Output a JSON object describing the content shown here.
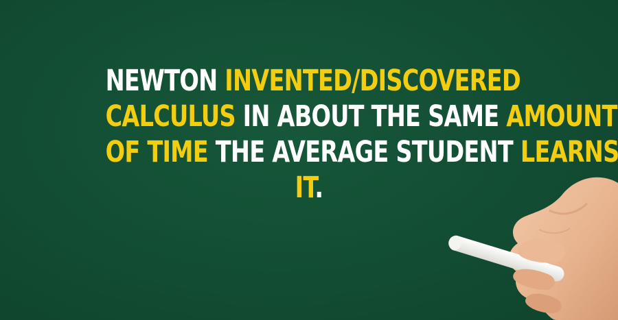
{
  "quote": {
    "line1": {
      "part1": "NEWTON",
      "part2": "INVENTED/DISCOVERED"
    },
    "line2": {
      "part1": "CALCULUS",
      "part2": "IN ABOUT THE SAME",
      "part3": "AMOUNT"
    },
    "line3": {
      "part1": "OF TIME",
      "part2": "THE AVERAGE STUDENT",
      "part3": "LEARNS"
    },
    "line4": {
      "part1": "IT",
      "part2": "."
    }
  },
  "colors": {
    "background": "#124d33",
    "text_white": "#ffffff",
    "text_highlight": "#f3cd0f"
  },
  "illustration": {
    "icon": "hand-holding-chalk-icon"
  }
}
